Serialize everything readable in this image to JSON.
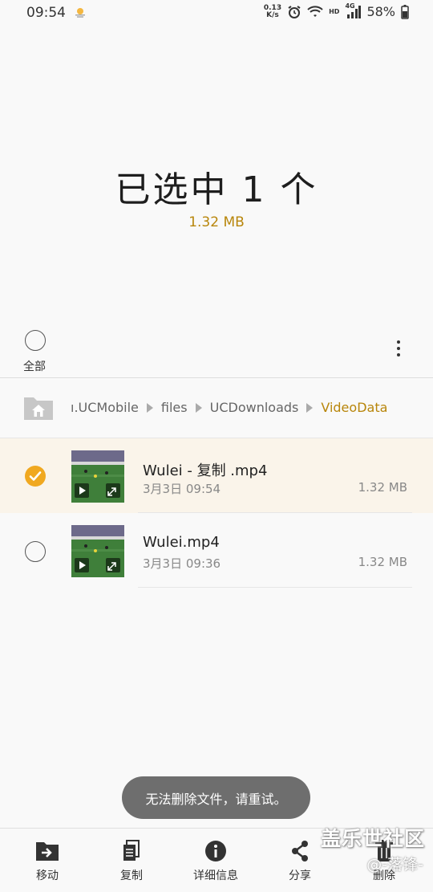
{
  "status_bar": {
    "time": "09:54",
    "speed_value": "0.13",
    "speed_unit": "K/s",
    "network": "HD",
    "network_gen": "4G",
    "battery": "58%"
  },
  "header": {
    "title": "已选中 1 个",
    "total_size": "1.32 MB"
  },
  "select_all": {
    "label": "全部"
  },
  "breadcrumb": {
    "items": [
      "ı.UCMobile",
      "files",
      "UCDownloads",
      "VideoData"
    ]
  },
  "files": [
    {
      "name": "Wulei - 复制 .mp4",
      "date": "3月3日 09:54",
      "size": "1.32 MB",
      "selected": true
    },
    {
      "name": "Wulei.mp4",
      "date": "3月3日 09:36",
      "size": "1.32 MB",
      "selected": false
    }
  ],
  "toast": {
    "message": "无法删除文件，请重试。"
  },
  "bottom_bar": {
    "move": "移动",
    "copy": "复制",
    "details": "详细信息",
    "share": "分享",
    "delete": "删除"
  },
  "watermark": {
    "line1": "盖乐世社区",
    "line2": "@-落锋-"
  },
  "colors": {
    "accent": "#b8860b",
    "check": "#f0a820",
    "selected_row": "#faf4ea",
    "toast": "#6e6e6e"
  }
}
